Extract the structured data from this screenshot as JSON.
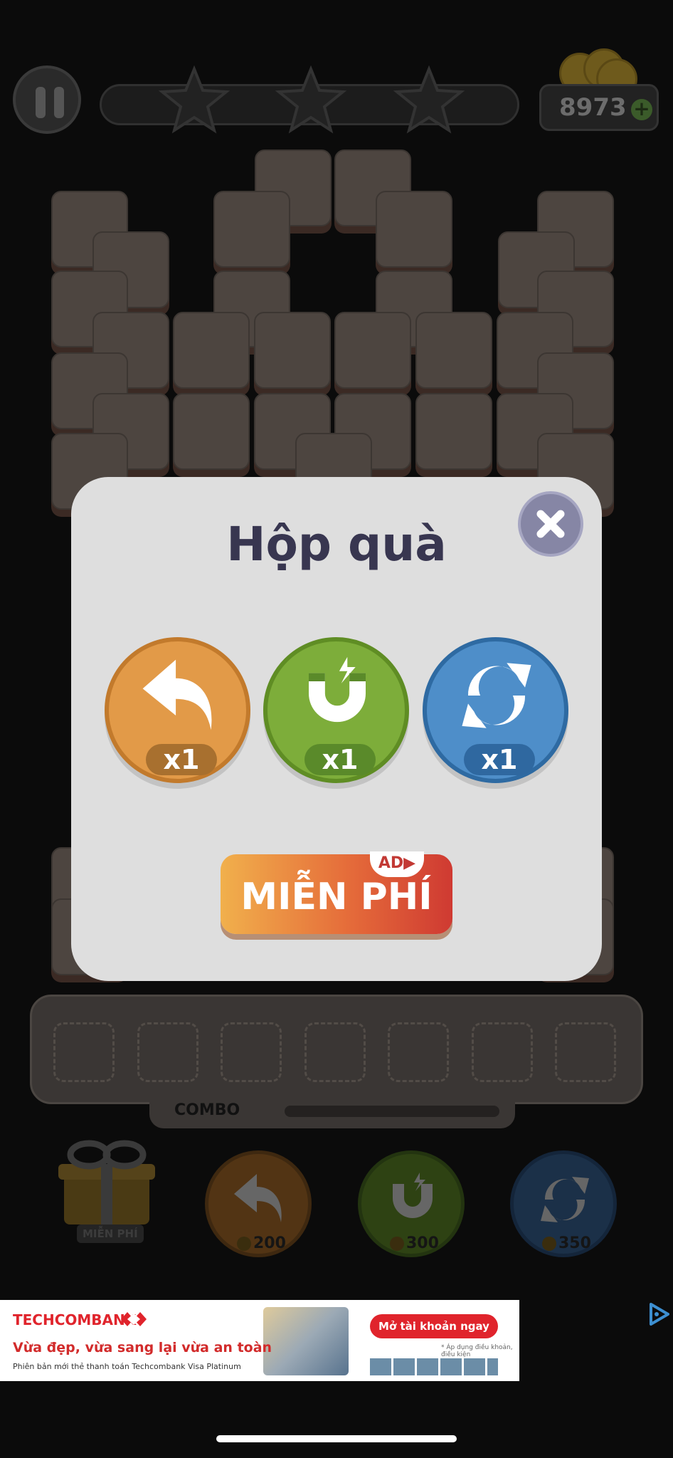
{
  "hud": {
    "coins": "8973",
    "coin_plus": "+"
  },
  "tray": {
    "combo_label": "COMBO"
  },
  "bottom_bar": {
    "gift_label": "MIỄN PHÍ",
    "undo_price": "200",
    "magnet_price": "300",
    "shuffle_price": "350"
  },
  "modal": {
    "title": "Hộp quà",
    "gifts": [
      {
        "icon": "undo-icon",
        "count": "x1",
        "color": "#e29a48"
      },
      {
        "icon": "magnet-icon",
        "count": "x1",
        "color": "#7dad3a"
      },
      {
        "icon": "shuffle-icon",
        "count": "x1",
        "color": "#4e8ec9"
      }
    ],
    "free_button_label": "MIỄN PHÍ",
    "ad_tag": "AD▶"
  },
  "banner_ad": {
    "brand": "TECHCOMBANK",
    "headline": "Vừa đẹp, vừa sang lại vừa an toàn",
    "subtext": "Phiên bản mới thẻ thanh toán Techcombank Visa Platinum",
    "cta": "Mở tài khoản ngay",
    "note": "* Áp dụng điều khoản, điều kiện"
  }
}
